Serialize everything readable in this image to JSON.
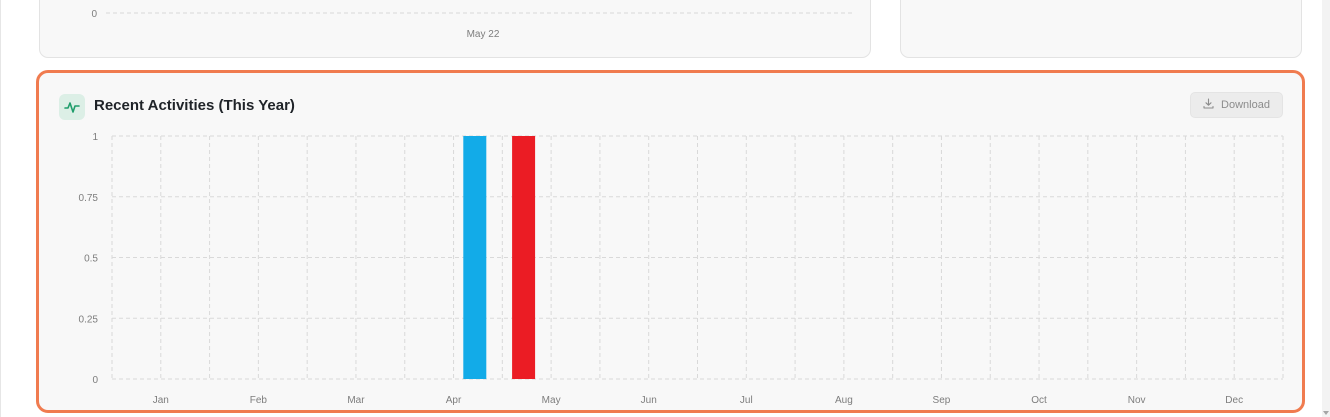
{
  "top_chart": {
    "y_tick": "0",
    "x_tick": "May 22"
  },
  "card": {
    "title": "Recent Activities (This Year)",
    "download_label": "Download",
    "header_icon": "activity-pulse-icon",
    "download_icon": "download-icon"
  },
  "colors": {
    "highlight_border": "#f07b4f",
    "series_blue": "#12abe8",
    "series_red": "#eb1c24"
  },
  "chart_data": {
    "type": "bar",
    "categories": [
      "Jan",
      "Feb",
      "Mar",
      "Apr",
      "May",
      "Jun",
      "Jul",
      "Aug",
      "Sep",
      "Oct",
      "Nov",
      "Dec"
    ],
    "series": [
      {
        "color": "#12abe8",
        "values": [
          0,
          0,
          0,
          1,
          0,
          0,
          0,
          0,
          0,
          0,
          0,
          0
        ]
      },
      {
        "color": "#eb1c24",
        "values": [
          0,
          0,
          0,
          0,
          1,
          0,
          0,
          0,
          0,
          0,
          0,
          0
        ]
      }
    ],
    "ylim": [
      0,
      1
    ],
    "yticks": [
      "0",
      "0.25",
      "0.5",
      "0.75",
      "1"
    ],
    "grid": true,
    "grid_style": "dashed"
  }
}
